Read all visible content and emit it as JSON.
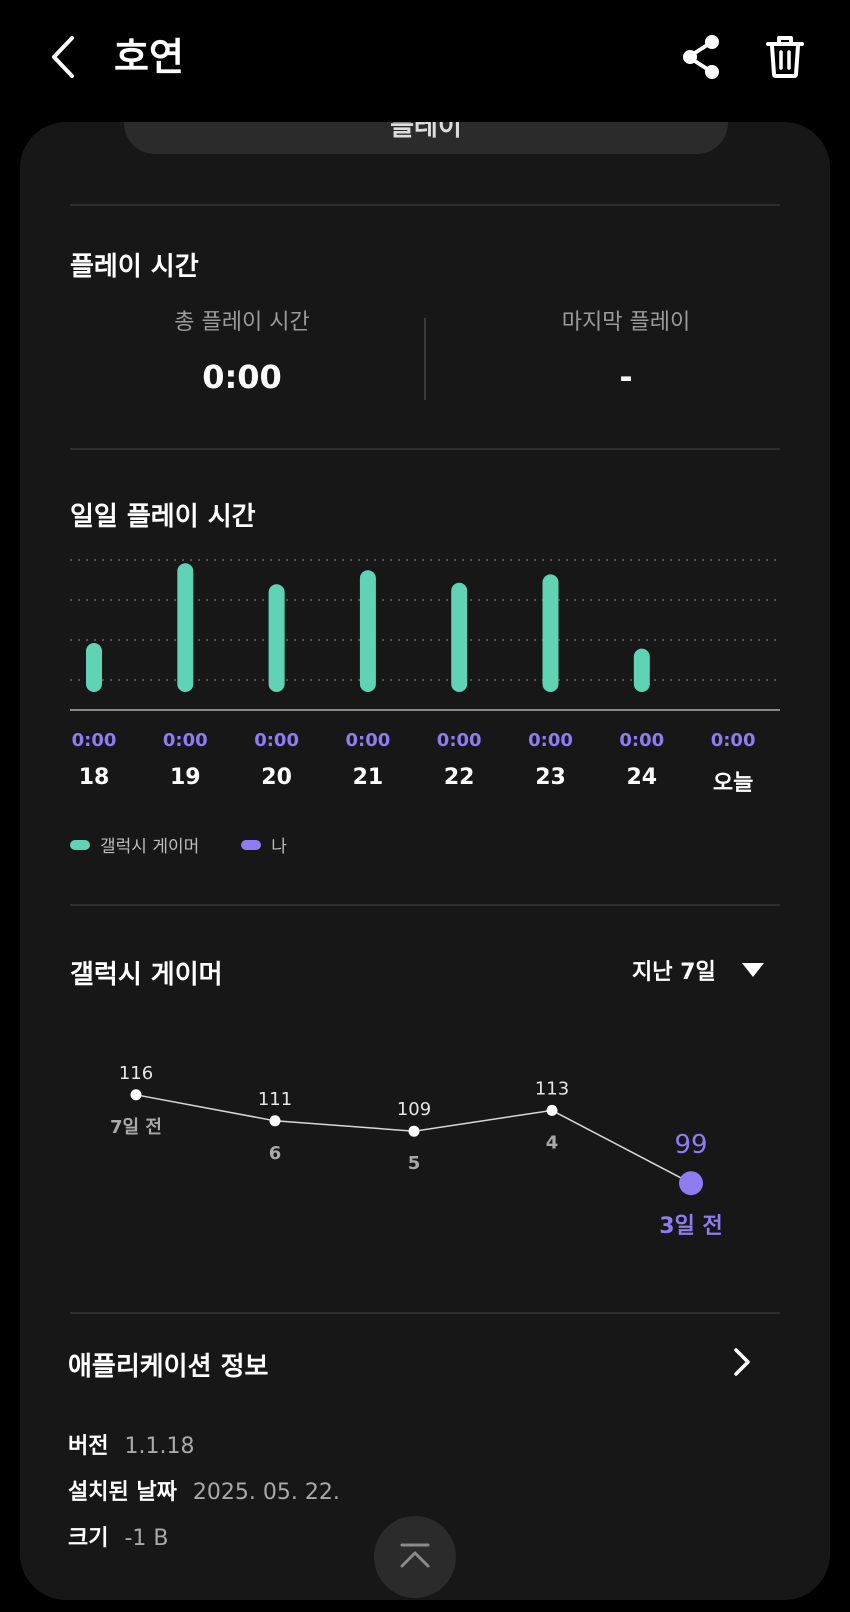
{
  "header": {
    "title": "호연"
  },
  "peek_button": {
    "label": "플레이"
  },
  "play_time": {
    "title": "플레이 시간",
    "total_label": "총 플레이 시간",
    "total_value": "0:00",
    "last_label": "마지막 플레이",
    "last_value": "-"
  },
  "daily": {
    "title": "일일 플레이 시간",
    "legend": [
      {
        "label": "갤럭시 게이머",
        "color": "#5fd3b4"
      },
      {
        "label": "나",
        "color": "#8f7cf2"
      }
    ]
  },
  "chart_data": {
    "type": "bar",
    "categories": [
      "18",
      "19",
      "20",
      "21",
      "22",
      "23",
      "24",
      "오늘"
    ],
    "series": [
      {
        "name": "갤럭시 게이머",
        "values": [
          0.35,
          0.92,
          0.77,
          0.87,
          0.78,
          0.84,
          0.31,
          0
        ]
      },
      {
        "name": "나",
        "values": [
          0,
          0,
          0,
          0,
          0,
          0,
          0,
          0
        ]
      }
    ],
    "me_labels": [
      "0:00",
      "0:00",
      "0:00",
      "0:00",
      "0:00",
      "0:00",
      "0:00",
      "0:00"
    ],
    "ylim": [
      0,
      1
    ],
    "grid": true
  },
  "ranking": {
    "title": "갤럭시 게이머",
    "period_label": "지난 7일",
    "points": [
      {
        "value": "116",
        "label": "7일 전",
        "highlight": false
      },
      {
        "value": "111",
        "label": "6",
        "highlight": false
      },
      {
        "value": "109",
        "label": "5",
        "highlight": false
      },
      {
        "value": "113",
        "label": "4",
        "highlight": false
      },
      {
        "value": "99",
        "label": "3일 전",
        "highlight": true
      }
    ]
  },
  "app_info": {
    "title": "애플리케이션 정보",
    "version_label": "버전",
    "version_value": "1.1.18",
    "installed_label": "설치된 날짜",
    "installed_value": "2025. 05. 22.",
    "size_label": "크기",
    "size_value": "-1 B"
  },
  "colors": {
    "accent_green": "#5fd3b4",
    "accent_purple": "#8f7cf2",
    "card_bg": "#171717"
  }
}
